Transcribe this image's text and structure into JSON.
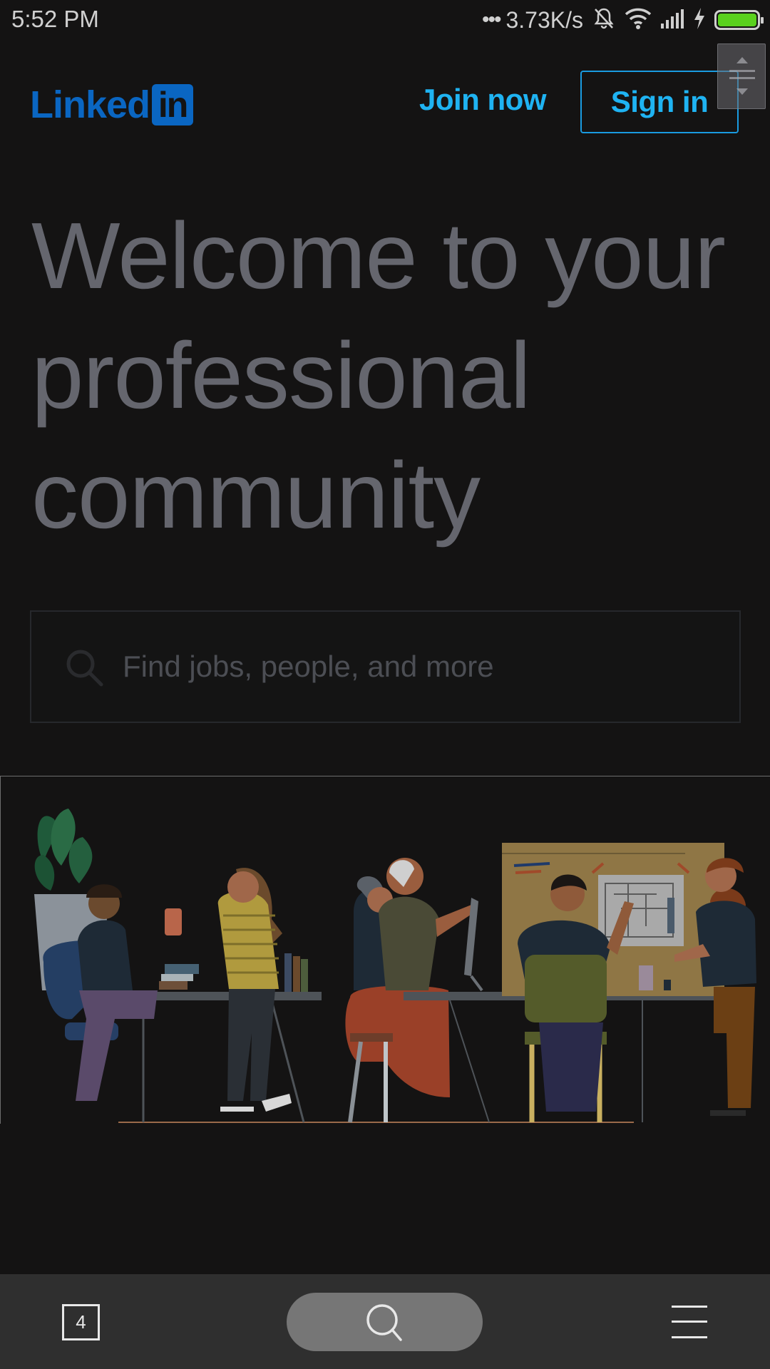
{
  "status_bar": {
    "time": "5:52 PM",
    "dots": "•••",
    "network_speed": "3.73K/s",
    "icons": [
      "bell-muted-icon",
      "wifi-icon",
      "signal-icon",
      "charging-icon",
      "battery-icon"
    ],
    "battery_level": 1.0,
    "battery_color": "#5ad11e"
  },
  "header": {
    "logo_text": "Linked",
    "logo_box": "in",
    "join_label": "Join now",
    "signin_label": "Sign in",
    "brand_color": "#0a66c2",
    "accent_color": "#1fb3f2"
  },
  "hero": {
    "line1": "Welcome to your",
    "line2": "professional",
    "line3": "community"
  },
  "search": {
    "placeholder": "Find jobs, people, and more",
    "icon": "search-icon"
  },
  "illustration": {
    "icon": "office-people-illustration"
  },
  "bottom_nav": {
    "tab_count": "4",
    "tabs_icon": "tabs-icon",
    "search_icon": "search-icon",
    "menu_icon": "menu-icon"
  }
}
